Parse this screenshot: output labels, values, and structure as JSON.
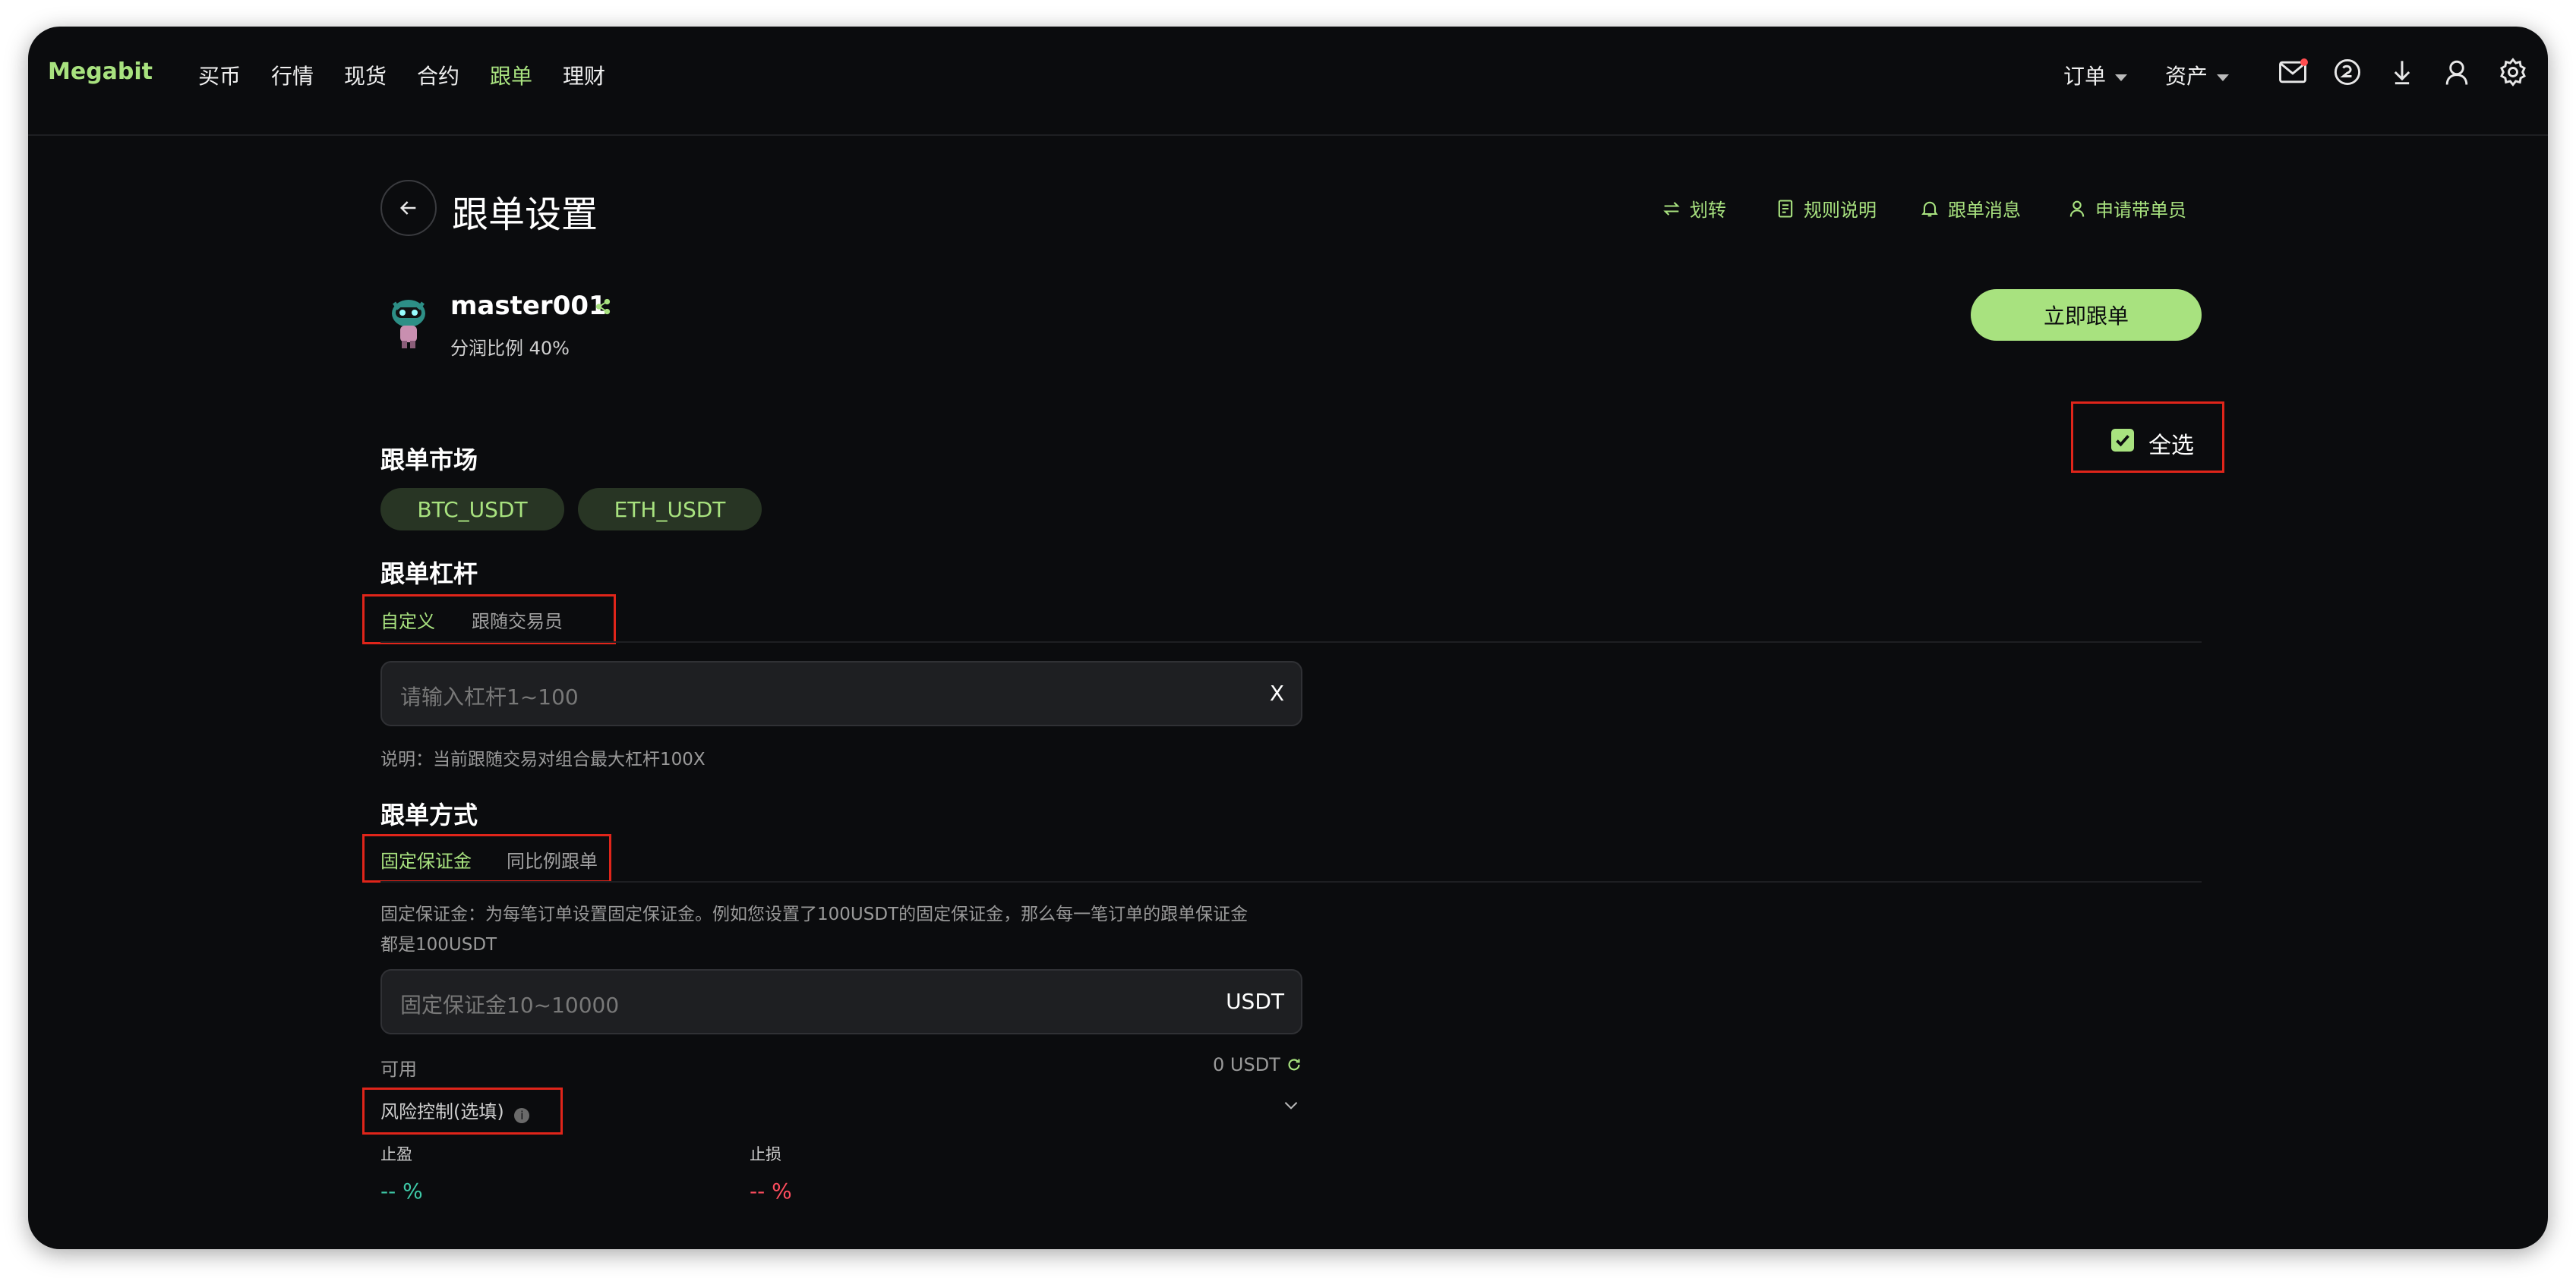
{
  "topbar": {
    "logo": "Megabit",
    "nav": [
      "买币",
      "行情",
      "现货",
      "合约",
      "跟单",
      "理财"
    ],
    "active_nav": "跟单",
    "dropdowns": [
      "订单",
      "资产"
    ],
    "icons": [
      "mail-icon",
      "refresh-circle-icon",
      "download-icon",
      "user-icon",
      "settings-icon"
    ]
  },
  "page": {
    "title": "跟单设置",
    "links": [
      "划转",
      "规则说明",
      "跟单消息",
      "申请带单员"
    ]
  },
  "trader": {
    "name": "master001",
    "ratio": "分润比例 40%",
    "follow_button": "立即跟单"
  },
  "select_all": "全选",
  "market": {
    "heading": "跟单市场",
    "chips": [
      "BTC_USDT",
      "ETH_USDT"
    ]
  },
  "leverage": {
    "heading": "跟单杠杆",
    "tabs": [
      "自定义",
      "跟随交易员"
    ],
    "placeholder": "请输入杠杆1~100",
    "suffix": "X",
    "note": "说明：当前跟随交易对组合最大杠杆100X"
  },
  "mode": {
    "heading": "跟单方式",
    "tabs": [
      "固定保证金",
      "同比例跟单"
    ],
    "desc_line1": "固定保证金：为每笔订单设置固定保证金。例如您设置了100USDT的固定保证金，那么每一笔订单的跟单保证金",
    "desc_line2": "都是100USDT",
    "placeholder": "固定保证金10~10000",
    "suffix": "USDT",
    "available_label": "可用",
    "available_value": "0 USDT"
  },
  "risk": {
    "label": "风险控制(选填)",
    "take_profit_label": "止盈",
    "take_profit_value": "-- %",
    "stop_loss_label": "止损",
    "stop_loss_value": "-- %"
  },
  "colors": {
    "accent": "#a8e27f",
    "profit": "#3ec9a7",
    "loss": "#ff4d5e",
    "highlight_box": "#e0251a"
  }
}
